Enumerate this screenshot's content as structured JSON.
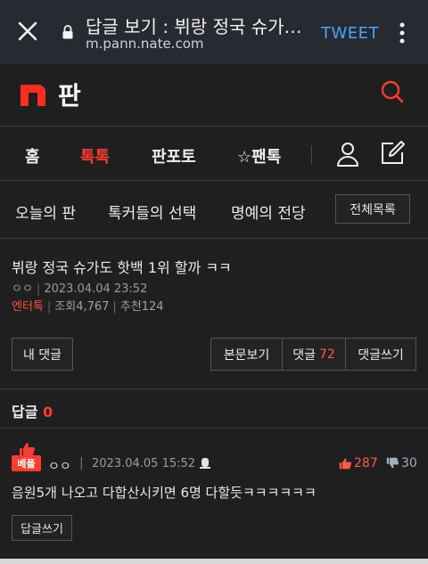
{
  "browser": {
    "title": "답글 보기 : 뷔랑 정국 슈가…",
    "url": "m.pann.nate.com",
    "tweet_label": "TWEET"
  },
  "header": {
    "logo_text": "판"
  },
  "nav": {
    "items": [
      {
        "label": "홈"
      },
      {
        "label": "톡톡"
      },
      {
        "label": "판포토"
      },
      {
        "label": "☆팬톡"
      }
    ]
  },
  "submenu": {
    "items": [
      {
        "label": "오늘의 판"
      },
      {
        "label": "톡커들의 선택"
      },
      {
        "label": "명예의 전당"
      }
    ],
    "full_list_label": "전체목록"
  },
  "post": {
    "title": "뷔랑 정국 슈가도 핫백 1위 할까 ㅋㅋ",
    "author": "ㅇㅇ",
    "date": "2023.04.04 23:52",
    "category": "엔터톡",
    "views": "조회4,767",
    "recommends": "추천124"
  },
  "actions": {
    "my_comments": "내 댓글",
    "view_original": "본문보기",
    "comments_label": "댓글",
    "comments_count": "72",
    "write_comment": "댓글쓰기"
  },
  "replies": {
    "label": "답글",
    "count": "0"
  },
  "comment": {
    "badge": "베플",
    "author": "ㅇㅇ",
    "date": "2023.04.05 15:52",
    "likes": "287",
    "dislikes": "30",
    "body": "음원5개 나오고 다합산시키면 6명 다할듯ㅋㅋㅋㅋㅋㅋ",
    "reply_label": "답글쓰기"
  },
  "colors": {
    "accent": "#ff3b30",
    "background": "#1f1f1f",
    "link": "#4aa3ff"
  }
}
